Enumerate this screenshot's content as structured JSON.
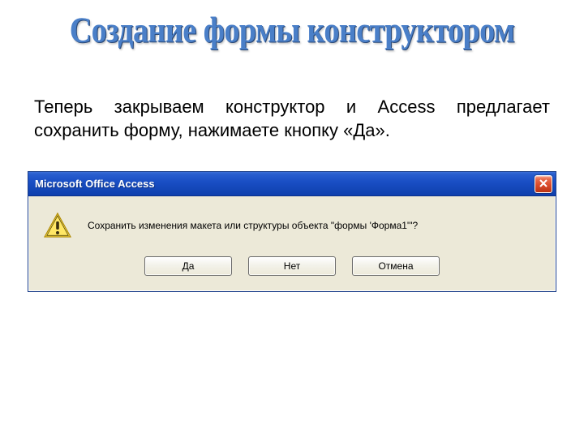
{
  "slide": {
    "title": "Создание формы конструктором",
    "body": "Теперь закрываем конструктор и Access предлагает сохранить форму, нажимаете кнопку «Да»."
  },
  "dialog": {
    "title": "Microsoft Office Access",
    "message": "Сохранить изменения макета или структуры объекта \"формы 'Форма1'\"?",
    "buttons": {
      "yes": "Да",
      "no": "Нет",
      "cancel": "Отмена"
    }
  }
}
